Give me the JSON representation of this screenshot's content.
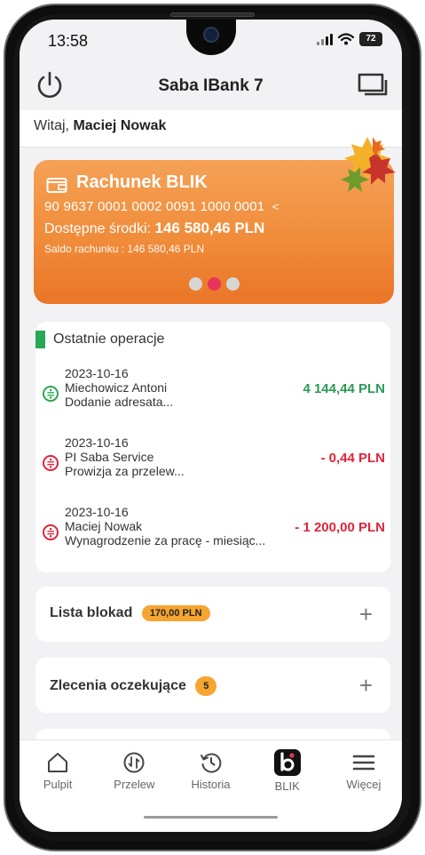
{
  "status_bar": {
    "time": "13:58",
    "battery": "72"
  },
  "app": {
    "title": "Saba IBank 7"
  },
  "greeting": {
    "prefix": "Witaj,",
    "name": "Maciej Nowak"
  },
  "account_card": {
    "name": "Rachunek BLIK",
    "number": "90 9637 0001 0002 0091 1000 0001",
    "available_label": "Dostępne środki:",
    "available_value": "146 580,46 PLN",
    "saldo_label": "Saldo rachunku :",
    "saldo_value": "146 580,46 PLN",
    "carousel_active_index": 1,
    "carousel_count": 3,
    "colors": {
      "gradient_top": "#f5a156",
      "gradient_bottom": "#ea7527",
      "active_dot": "#e8345a"
    }
  },
  "recent_operations": {
    "title": "Ostatnie operacje",
    "items": [
      {
        "date": "2023-10-16",
        "party": "Miechowicz Antoni",
        "description": "Dodanie adresata...",
        "amount": "4 144,44 PLN",
        "direction": "in"
      },
      {
        "date": "2023-10-16",
        "party": "PI Saba Service",
        "description": "Prowizja za przelew...",
        "amount": "- 0,44 PLN",
        "direction": "out"
      },
      {
        "date": "2023-10-16",
        "party": "Maciej Nowak",
        "description": "Wynagrodzenie za pracę - miesiąc...",
        "amount": "- 1 200,00 PLN",
        "direction": "out"
      }
    ]
  },
  "blocks_panel": {
    "label": "Lista blokad",
    "badge": "170,00 PLN"
  },
  "pending_panel": {
    "label": "Zlecenia oczekujące",
    "badge": "5"
  },
  "tabbar": {
    "items": [
      {
        "label": "Pulpit",
        "icon": "home-icon"
      },
      {
        "label": "Przelew",
        "icon": "transfer-icon"
      },
      {
        "label": "Historia",
        "icon": "history-icon"
      },
      {
        "label": "BLIK",
        "icon": "blik-icon"
      },
      {
        "label": "Więcej",
        "icon": "menu-icon"
      }
    ]
  }
}
